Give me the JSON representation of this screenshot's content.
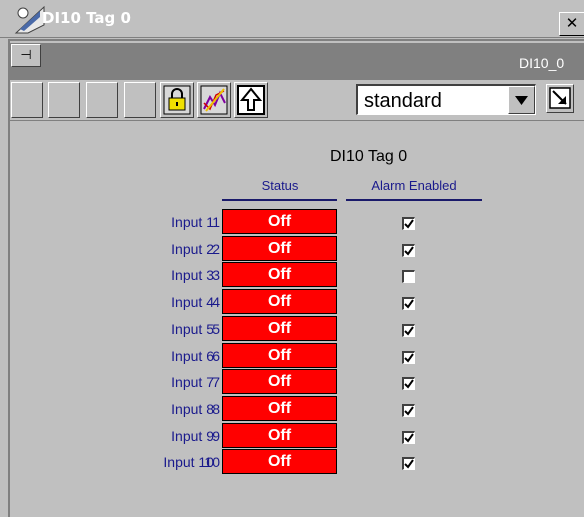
{
  "window": {
    "title": "DI10 Tag 0",
    "close_label": "✕"
  },
  "panel": {
    "title": "DI10_0",
    "pin_label": "⊣"
  },
  "toolbar": {
    "empty_buttons": 4,
    "buttons": [
      "lock-icon",
      "trend-icon",
      "up-arrow-icon"
    ],
    "view_select": {
      "value": "standard",
      "options": [
        "standard"
      ]
    }
  },
  "device": {
    "title": "DI10 Tag 0",
    "columns": {
      "status": "Status",
      "alarm": "Alarm Enabled"
    }
  },
  "inputs": [
    {
      "label": "Input 1",
      "num": "1",
      "status": "Off",
      "alarm_enabled": true
    },
    {
      "label": "Input 2",
      "num": "2",
      "status": "Off",
      "alarm_enabled": true
    },
    {
      "label": "Input 3",
      "num": "3",
      "status": "Off",
      "alarm_enabled": false
    },
    {
      "label": "Input 4",
      "num": "4",
      "status": "Off",
      "alarm_enabled": true
    },
    {
      "label": "Input 5",
      "num": "5",
      "status": "Off",
      "alarm_enabled": true
    },
    {
      "label": "Input 6",
      "num": "6",
      "status": "Off",
      "alarm_enabled": true
    },
    {
      "label": "Input 7",
      "num": "7",
      "status": "Off",
      "alarm_enabled": true
    },
    {
      "label": "Input 8",
      "num": "8",
      "status": "Off",
      "alarm_enabled": true
    },
    {
      "label": "Input 9",
      "num": "9",
      "status": "Off",
      "alarm_enabled": true
    },
    {
      "label": "Input 10",
      "num": "10",
      "status": "Off",
      "alarm_enabled": true
    }
  ],
  "colors": {
    "status_off": "#ff0000",
    "label_text": "#1a1a8c",
    "panel_head": "#808080"
  }
}
